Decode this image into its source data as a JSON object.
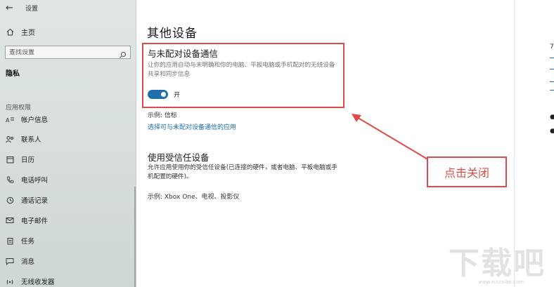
{
  "window": {
    "app_title": "设置"
  },
  "sidebar": {
    "home_label": "主页",
    "search_placeholder": "查找设置",
    "privacy_title": "隐私",
    "section_label": "应用权限",
    "items": [
      {
        "label": "帐户信息",
        "icon": "account-info-icon"
      },
      {
        "label": "联系人",
        "icon": "contacts-icon"
      },
      {
        "label": "日历",
        "icon": "calendar-icon"
      },
      {
        "label": "电话呼叫",
        "icon": "phone-icon"
      },
      {
        "label": "通话记录",
        "icon": "call-history-icon"
      },
      {
        "label": "电子邮件",
        "icon": "email-icon"
      },
      {
        "label": "任务",
        "icon": "tasks-icon"
      },
      {
        "label": "消息",
        "icon": "messaging-icon"
      },
      {
        "label": "无线收发器",
        "icon": "radios-icon"
      }
    ]
  },
  "main": {
    "title": "其他设备",
    "section1": {
      "title": "与未配对设备通信",
      "description": "让你的应用自动与未明确和你的电脑、平板电脑或手机配对的无线设备共享和同步信息",
      "toggle_label": "开",
      "toggle_state": "on",
      "example": "示例: 信标",
      "link": "选择可与未配对设备通信的应用"
    },
    "section2": {
      "title": "使用受信任设备",
      "description": "允许应用使用你的受信任设备(已连接的硬件，或者电脑、平板电脑或手机配置的硬件)。",
      "example": "示例: Xbox One、电视、投影仪"
    }
  },
  "annotation": {
    "callout_text": "点击关闭",
    "color": "#e14a4a"
  },
  "watermark": {
    "text": "下载吧",
    "url": "www.xiazaiba.com"
  },
  "colors": {
    "accent": "#1f6fa8",
    "link": "#1a6fb5",
    "annotation": "#e14a4a"
  }
}
